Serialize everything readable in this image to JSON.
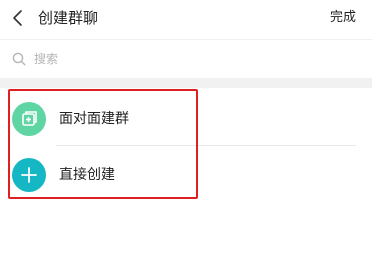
{
  "header": {
    "back_icon": "chevron-left-icon",
    "title": "创建群聊",
    "done_label": "完成"
  },
  "search": {
    "icon": "search-icon",
    "placeholder": "搜索"
  },
  "options": [
    {
      "label": "面对面建群",
      "icon": "face-to-face-group-icon",
      "color": "#5fd5a3"
    },
    {
      "label": "直接创建",
      "icon": "plus-icon",
      "color": "#15b7c4"
    }
  ],
  "highlight_color": "#e02020"
}
